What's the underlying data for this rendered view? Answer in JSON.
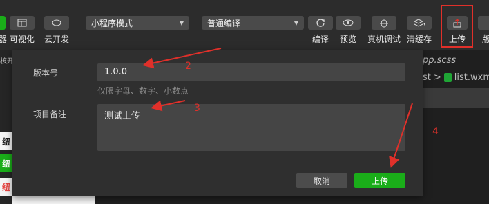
{
  "toolbar": {
    "simulator": "器",
    "visual": "可视化",
    "cloud": "云开发",
    "mode_select": "小程序模式",
    "compile_select": "普通编译",
    "compile": "编译",
    "preview": "预览",
    "remote_debug": "真机调试",
    "clear_cache": "清缓存",
    "upload": "上传",
    "version": "版本"
  },
  "background": {
    "left_top_text": "核开",
    "tab_file": "pp.scss",
    "breadcrumb_prefix": "st",
    "breadcrumb_sep": ">",
    "breadcrumb_file": "list.wxm",
    "side_items": [
      "纽",
      "纽",
      "纽"
    ]
  },
  "dialog": {
    "version_label": "版本号",
    "version_value": "1.0.0",
    "version_hint": "仅限字母、数字、小数点",
    "note_label": "项目备注",
    "note_value": "测试上传",
    "cancel": "取消",
    "upload": "上传"
  },
  "annotations": [
    "2",
    "3",
    "4"
  ],
  "colors": {
    "accent_green": "#1aad19",
    "annotation_red": "#e0302a"
  }
}
